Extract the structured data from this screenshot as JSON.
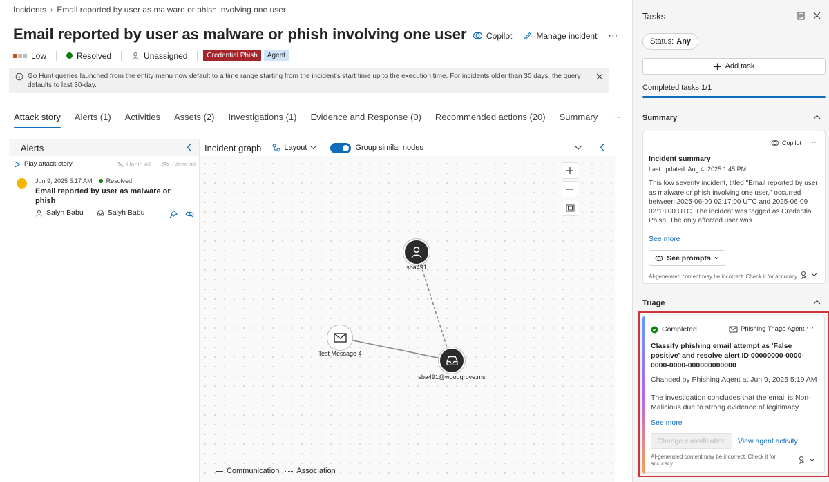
{
  "breadcrumb": {
    "root": "Incidents",
    "current": "Email reported by user as malware or phish involving one user"
  },
  "incident": {
    "title": "Email reported by user as malware or phish involving one user",
    "severity": "Low",
    "status": "Resolved",
    "assignee": "Unassigned",
    "tags": [
      {
        "label": "Credential Phish",
        "color": "#a4262c"
      },
      {
        "label": "Agent",
        "color": "#cfe4fa"
      }
    ]
  },
  "header_actions": {
    "copilot": "Copilot",
    "manage": "Manage incident",
    "more": "⋯"
  },
  "banner": {
    "text": "Go Hunt queries launched from the entity menu now default to a time range starting from the incident's start time up to the execution time. For incidents older than 30 days, the query defaults to last 30-day."
  },
  "tabs": [
    {
      "label": "Attack story",
      "active": true
    },
    {
      "label": "Alerts (1)"
    },
    {
      "label": "Activities"
    },
    {
      "label": "Assets (2)"
    },
    {
      "label": "Investigations (1)"
    },
    {
      "label": "Evidence and Response (0)"
    },
    {
      "label": "Recommended actions (20)"
    },
    {
      "label": "Summary"
    },
    {
      "label": "⋯"
    }
  ],
  "alerts_panel": {
    "title": "Alerts",
    "play": "Play attack story",
    "unpin": "Unpin all",
    "show": "Show all",
    "alert": {
      "date": "Jun 9, 2025 5:17 AM",
      "status": "Resolved",
      "title": "Email reported by user as malware or phish",
      "user1": "Salyh Babu",
      "user2": "Salyh Babu"
    }
  },
  "graph": {
    "title": "Incident graph",
    "layout": "Layout",
    "group_toggle": "Group similar nodes",
    "nodes": {
      "user": "sba491",
      "message": "Test Message 4",
      "mailbox": "sba491@woodgrove.ms"
    },
    "legend": {
      "communication": "Communication",
      "association": "Association"
    }
  },
  "tasks": {
    "title": "Tasks",
    "status_filter_label": "Status:",
    "status_filter_value": "Any",
    "add_task": "Add task",
    "completed": "Completed tasks 1/1",
    "completed_fraction": 1.0
  },
  "summary": {
    "section": "Summary",
    "copilot": "Copilot",
    "heading": "Incident summary",
    "updated": "Last updated: Aug 4, 2025 1:45 PM",
    "body": "This low severity incident, titled \"Email reported by user as malware or phish involving one user,\" occurred between 2025-06-09 02:17:00 UTC and 2025-06-09 02:18:00 UTC. The incident was tagged as Credential Phish. The only affected user was",
    "see_more": "See more",
    "see_prompts": "See prompts",
    "disclaimer": "AI-generated content may be incorrect. Check it for accuracy."
  },
  "triage": {
    "section": "Triage",
    "status": "Completed",
    "agent": "Phishing Triage Agent",
    "heading": "Classify phishing email attempt as 'False positive' and resolve alert ID 00000000-0000-0000-0000-000000000000",
    "changed": "Changed by Phishing Agent at Jun 9, 2025 5:19 AM",
    "body": "The investigation concludes that the email is Non-Malicious due to strong evidence of legitimacy",
    "see_more": "See more",
    "change_btn": "Change classification",
    "view_activity": "View agent activity",
    "disclaimer": "AI-generated content may be incorrect. Check it for accuracy."
  },
  "colors": {
    "accent": "#0f6cbd",
    "resolved": "#107c10",
    "highlight": "#d13438"
  }
}
